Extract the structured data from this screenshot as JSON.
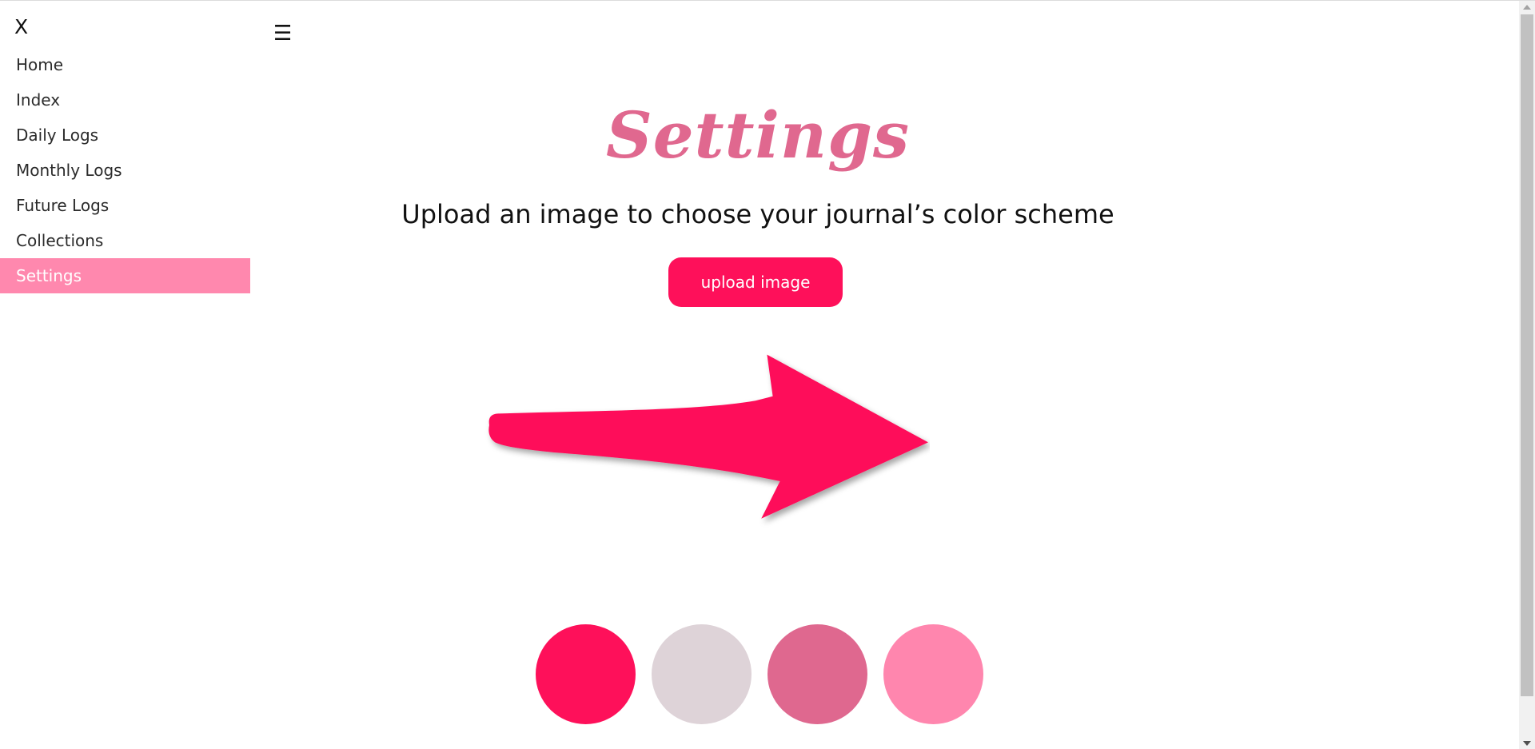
{
  "sidebar": {
    "close_label": "X",
    "items": [
      {
        "label": "Home",
        "active": false
      },
      {
        "label": "Index",
        "active": false
      },
      {
        "label": "Daily Logs",
        "active": false
      },
      {
        "label": "Monthly Logs",
        "active": false
      },
      {
        "label": "Future Logs",
        "active": false
      },
      {
        "label": "Collections",
        "active": false
      },
      {
        "label": "Settings",
        "active": true
      }
    ]
  },
  "header": {
    "menu_icon": "☰"
  },
  "main": {
    "title": "Settings",
    "subtitle": "Upload an image to choose your journal’s color scheme",
    "upload_button": "upload image",
    "arrow_icon": "arrow-right-icon"
  },
  "palette": {
    "swatches": [
      "#fe105a",
      "#ded3d8",
      "#df688f",
      "#ff86ae"
    ]
  },
  "colors": {
    "accent": "#fe105a",
    "title": "#e0688f",
    "active_nav": "#ff88ae"
  }
}
